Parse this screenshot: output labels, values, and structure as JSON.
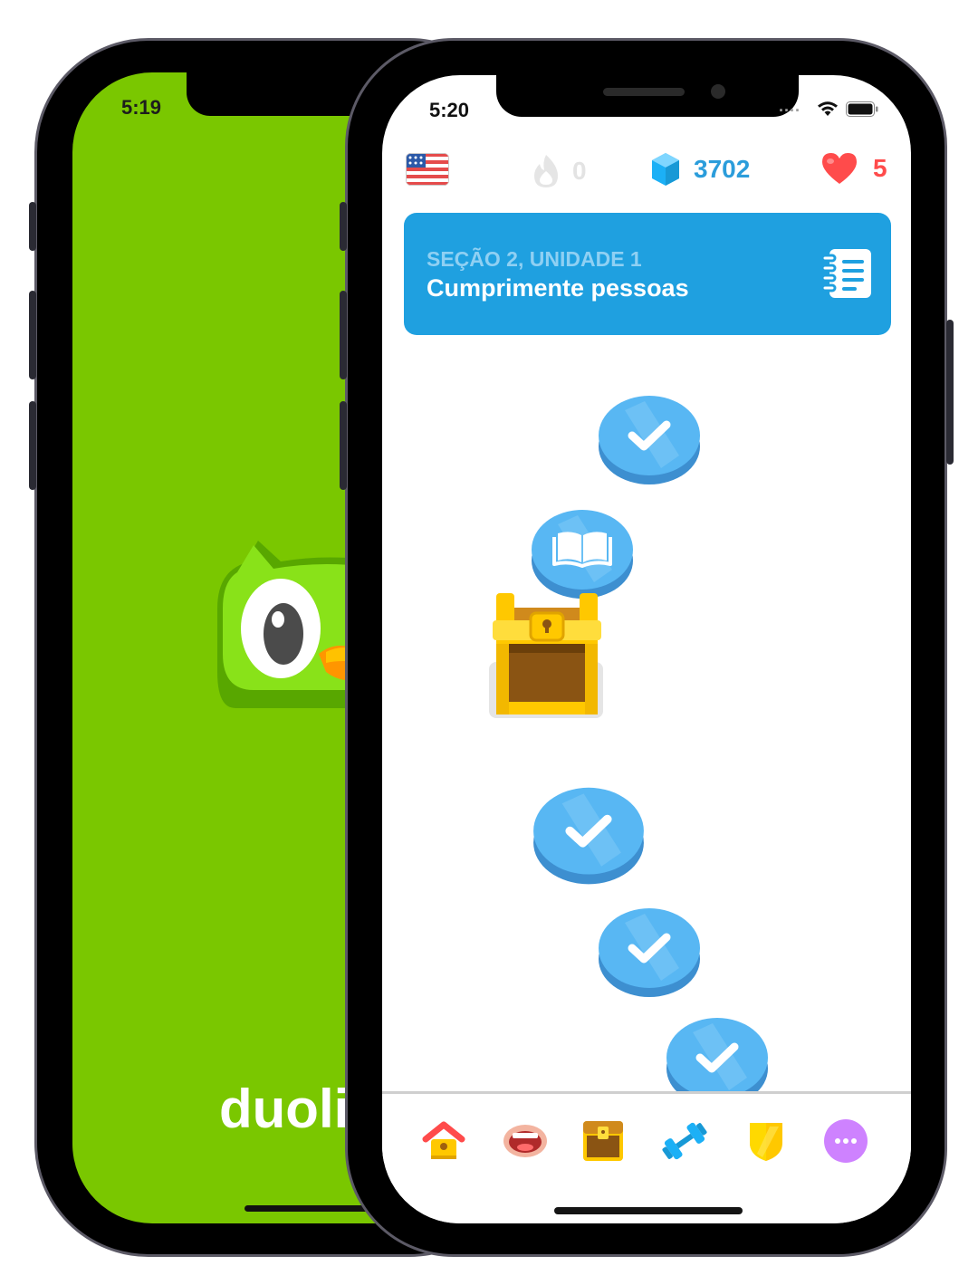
{
  "back_phone": {
    "status_time": "5:19",
    "wordmark": "duoli",
    "background_color": "#7ac700"
  },
  "status_bar": {
    "time": "5:20",
    "signal_dots": "....",
    "icons": [
      "wifi-icon",
      "battery-icon"
    ]
  },
  "top_bar": {
    "language_flag": "us-flag-icon",
    "streak_count": "0",
    "gems_count": "3702",
    "hearts_count": "5"
  },
  "unit": {
    "section_label": "SEÇÃO 2, UNIDADE 1",
    "title": "Cumprimente pessoas",
    "guide_icon": "notebook-icon",
    "color": "#1fa0e0"
  },
  "path_nodes": [
    {
      "type": "completed",
      "icon": "checkmark-icon"
    },
    {
      "type": "story",
      "icon": "book-icon"
    },
    {
      "type": "chest",
      "icon": "treasure-chest-icon"
    },
    {
      "type": "completed",
      "icon": "checkmark-icon"
    },
    {
      "type": "completed",
      "icon": "checkmark-icon"
    },
    {
      "type": "completed",
      "icon": "checkmark-icon"
    }
  ],
  "tab_bar": [
    {
      "name": "learn",
      "icon": "home-icon"
    },
    {
      "name": "practice-speaking",
      "icon": "mouth-icon"
    },
    {
      "name": "chests",
      "icon": "chest-icon"
    },
    {
      "name": "practice",
      "icon": "dumbbell-icon"
    },
    {
      "name": "leagues",
      "icon": "shield-icon"
    },
    {
      "name": "more",
      "icon": "more-icon"
    }
  ],
  "colors": {
    "node_blue": "#58b7f3",
    "node_blue_dark": "#3d8fd0",
    "gem_blue": "#2b9ddb",
    "heart_red": "#ff4b4b"
  }
}
